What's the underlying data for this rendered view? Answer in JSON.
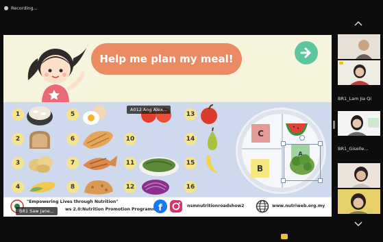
{
  "recording": {
    "label": "Recording..."
  },
  "slide": {
    "title": "Help me plan my meal!",
    "food_numbers": [
      "1",
      "2",
      "3",
      "4",
      "5",
      "6",
      "7",
      "8",
      "10",
      "11",
      "12",
      "13",
      "14",
      "15",
      "16"
    ],
    "plate_labels": {
      "c": "C",
      "b": "B",
      "a": "A"
    },
    "presenter_tag": "A012 Ang Alex...",
    "footer": {
      "line1": "\"Empowering Lives through Nutrition\"",
      "line2": "ws 2.0:Nutrition Promotion Programme",
      "social": "nsmnutritionroadshow2",
      "website": "www.nutriweb.org.my"
    },
    "speaker_tag": "BR1 Saw Jane..."
  },
  "participants": [
    {
      "name": ""
    },
    {
      "name": "BR1_Lam Jia Qi"
    },
    {
      "name": "BR1_Giselle..."
    },
    {
      "name": ""
    },
    {
      "name": ""
    }
  ],
  "colors": {
    "accent_orange": "#ea8b64",
    "next_green": "#5ec5a1",
    "square_c": "#e59a95",
    "square_b": "#f7e781"
  }
}
